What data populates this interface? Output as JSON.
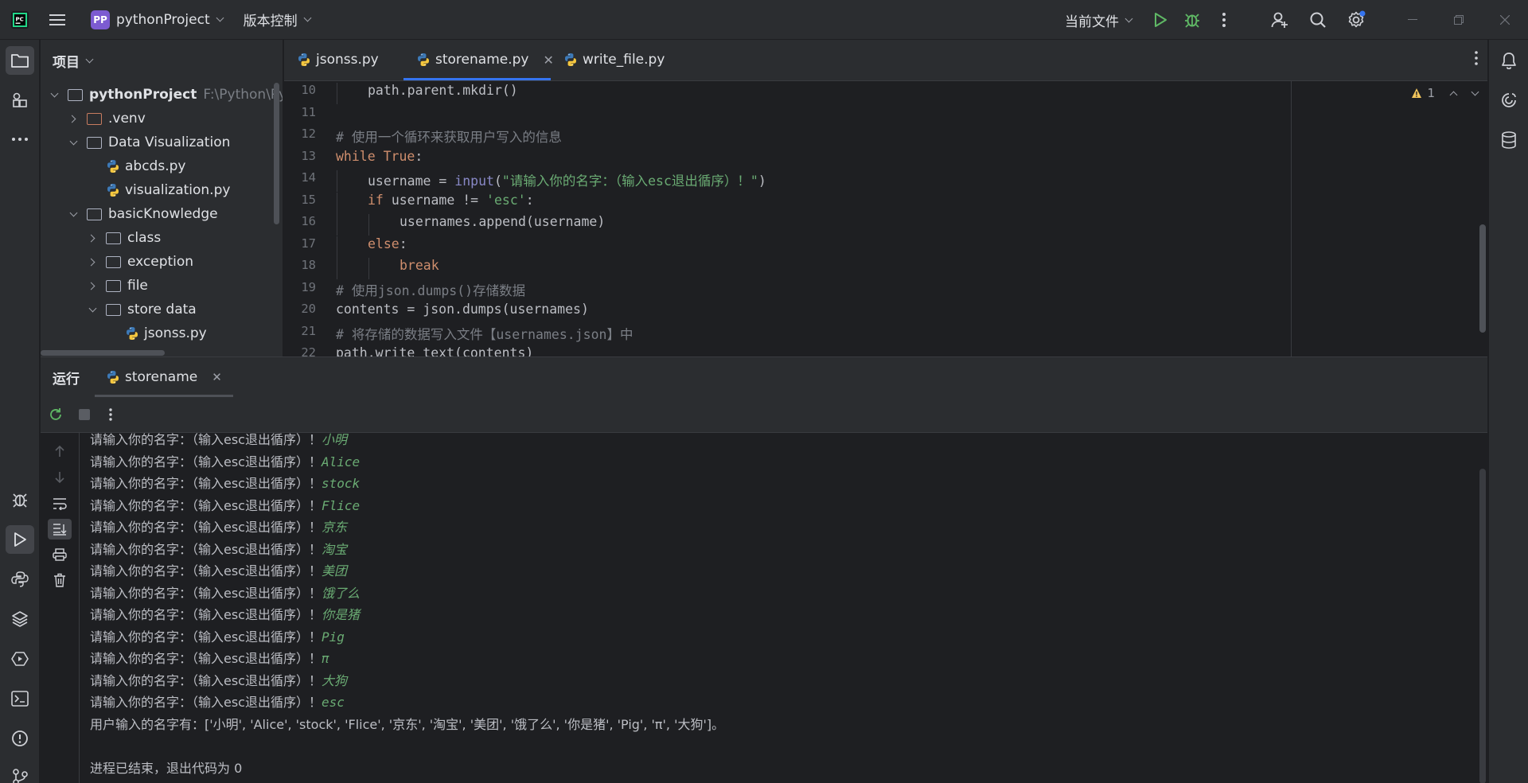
{
  "titlebar": {
    "project_badge": "PP",
    "project_name": "pythonProject",
    "vcs_label": "版本控制",
    "run_config": "当前文件"
  },
  "project_panel": {
    "title": "项目",
    "tree": [
      {
        "label": "pythonProject",
        "hint": "F:\\Python\\Pych",
        "type": "folder",
        "level": 0,
        "expanded": true,
        "bold": true
      },
      {
        "label": ".venv",
        "type": "folder-venv",
        "level": 1,
        "expanded": false
      },
      {
        "label": "Data Visualization",
        "type": "folder",
        "level": 1,
        "expanded": true
      },
      {
        "label": "abcds.py",
        "type": "py",
        "level": 2
      },
      {
        "label": "visualization.py",
        "type": "py",
        "level": 2
      },
      {
        "label": "basicKnowledge",
        "type": "folder",
        "level": 1,
        "expanded": true
      },
      {
        "label": "class",
        "type": "folder",
        "level": 2,
        "expanded": false
      },
      {
        "label": "exception",
        "type": "folder",
        "level": 2,
        "expanded": false
      },
      {
        "label": "file",
        "type": "folder",
        "level": 2,
        "expanded": false
      },
      {
        "label": "store data",
        "type": "folder",
        "level": 2,
        "expanded": true
      },
      {
        "label": "jsonss.py",
        "type": "py",
        "level": 3
      }
    ]
  },
  "editor": {
    "tabs": [
      {
        "label": "jsonss.py",
        "active": false
      },
      {
        "label": "storename.py",
        "active": true
      },
      {
        "label": "write_file.py",
        "active": false
      }
    ],
    "warning_count": "1",
    "lines": [
      {
        "n": "10",
        "indent": 1,
        "tokens": [
          {
            "t": "path.parent.mkdir()",
            "c": ""
          }
        ]
      },
      {
        "n": "11",
        "indent": 0,
        "tokens": []
      },
      {
        "n": "12",
        "indent": 0,
        "tokens": [
          {
            "t": "# 使用一个循环来获取用户写入的信息",
            "c": "cm"
          }
        ]
      },
      {
        "n": "13",
        "indent": 0,
        "tokens": [
          {
            "t": "while ",
            "c": "kw"
          },
          {
            "t": "True",
            "c": "kw"
          },
          {
            "t": ":",
            "c": ""
          }
        ]
      },
      {
        "n": "14",
        "indent": 1,
        "tokens": [
          {
            "t": "username = ",
            "c": ""
          },
          {
            "t": "input",
            "c": "builtin"
          },
          {
            "t": "(",
            "c": ""
          },
          {
            "t": "\"请输入你的名字：（输入esc退出循序）！\"",
            "c": "str"
          },
          {
            "t": ")",
            "c": ""
          }
        ]
      },
      {
        "n": "15",
        "indent": 1,
        "tokens": [
          {
            "t": "if ",
            "c": "kw"
          },
          {
            "t": "username != ",
            "c": ""
          },
          {
            "t": "'esc'",
            "c": "str"
          },
          {
            "t": ":",
            "c": ""
          }
        ]
      },
      {
        "n": "16",
        "indent": 2,
        "tokens": [
          {
            "t": "usernames.append(username)",
            "c": ""
          }
        ]
      },
      {
        "n": "17",
        "indent": 1,
        "tokens": [
          {
            "t": "else",
            "c": "kw"
          },
          {
            "t": ":",
            "c": ""
          }
        ]
      },
      {
        "n": "18",
        "indent": 2,
        "tokens": [
          {
            "t": "break",
            "c": "kw"
          }
        ]
      },
      {
        "n": "19",
        "indent": 0,
        "tokens": [
          {
            "t": "# 使用json.dumps()存储数据",
            "c": "cm"
          }
        ]
      },
      {
        "n": "20",
        "indent": 0,
        "tokens": [
          {
            "t": "contents = json.dumps(usernames)",
            "c": ""
          }
        ]
      },
      {
        "n": "21",
        "indent": 0,
        "tokens": [
          {
            "t": "# 将存储的数据写入文件【usernames.json】中",
            "c": "cm"
          }
        ]
      },
      {
        "n": "22",
        "indent": 0,
        "tokens": [
          {
            "t": "path.write_text(contents)",
            "c": ""
          }
        ]
      }
    ]
  },
  "run_panel": {
    "title": "运行",
    "tab_label": "storename",
    "prompt": "请输入你的名字：（输入esc退出循序）！",
    "inputs": [
      "小明",
      "Alice",
      "stock",
      "Flice",
      "京东",
      "淘宝",
      "美团",
      "饿了么",
      "你是猪",
      "Pig",
      "π",
      "大狗",
      "esc"
    ],
    "result_line": "用户输入的名字有：['小明', 'Alice', 'stock', 'Flice', '京东', '淘宝', '美团', '饿了么', '你是猪', 'Pig', 'π', '大狗']。",
    "exit_line": "进程已结束，退出代码为 0"
  }
}
